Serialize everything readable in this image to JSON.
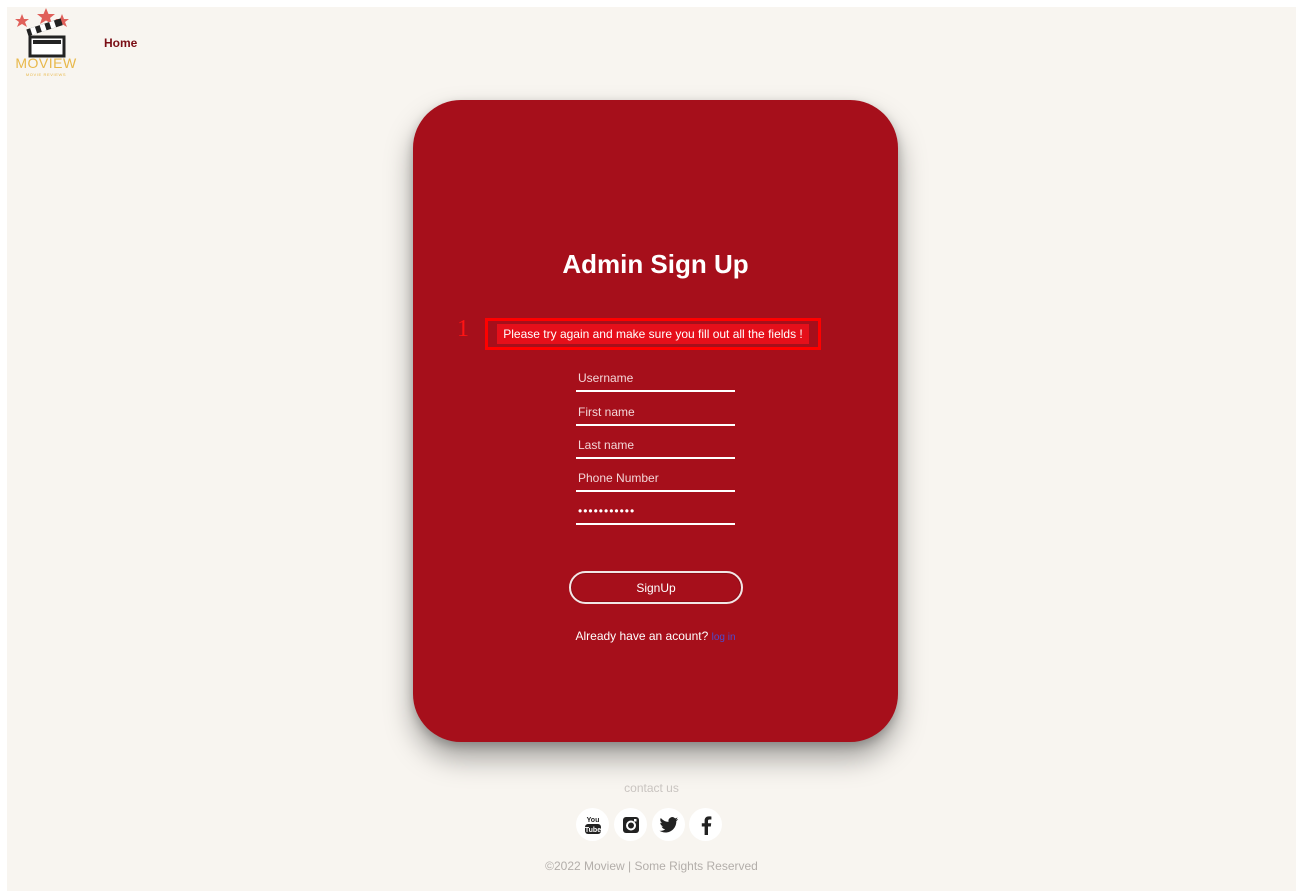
{
  "header": {
    "logo_text": "MOVIEW",
    "logo_subtext": "MOVIE REVIEWS",
    "nav_home": "Home"
  },
  "form": {
    "title": "Admin Sign Up",
    "annotation_marker": "1",
    "error_message": "Please try again and make sure you fill out all the fields !",
    "fields": {
      "username": {
        "placeholder": "Username",
        "value": ""
      },
      "first_name": {
        "placeholder": "First name",
        "value": ""
      },
      "last_name": {
        "placeholder": "Last name",
        "value": ""
      },
      "phone": {
        "placeholder": "Phone Number",
        "value": ""
      },
      "password": {
        "placeholder": "",
        "value": "•••••••••••"
      }
    },
    "submit_label": "SignUp",
    "account_prompt": "Already have an acount?",
    "login_link": "log in"
  },
  "footer": {
    "contact_label": "contact us",
    "social_icons": [
      "youtube-icon",
      "instagram-icon",
      "twitter-icon",
      "facebook-icon"
    ],
    "copyright": "©2022 Moview | Some Rights Reserved"
  },
  "colors": {
    "background": "#f8f5f0",
    "card": "#a60f1b",
    "error_border": "#ff0000",
    "logo_gold": "#e8b84a",
    "nav": "#7a0d14"
  }
}
